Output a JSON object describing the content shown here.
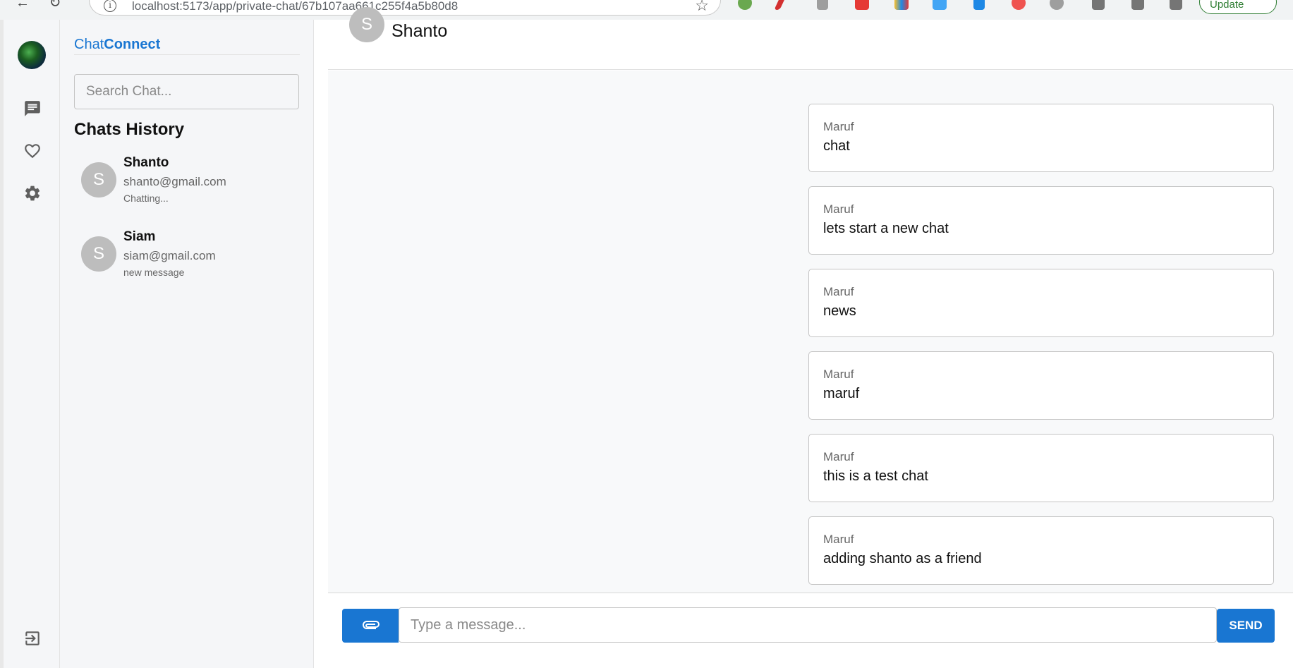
{
  "browser": {
    "url": "localhost:5173/app/private-chat/67b107aa661c255f4a5b80d8",
    "update_label": "Update"
  },
  "rail": {
    "icons": [
      "avatar",
      "chat-icon",
      "heart-icon",
      "gear-icon",
      "logout-icon"
    ]
  },
  "brand": {
    "part1": "Chat",
    "part2": "Connect"
  },
  "search": {
    "placeholder": "Search Chat..."
  },
  "history": {
    "title": "Chats History",
    "items": [
      {
        "initial": "S",
        "name": "Shanto",
        "email": "shanto@gmail.com",
        "status": "Chatting..."
      },
      {
        "initial": "S",
        "name": "Siam",
        "email": "siam@gmail.com",
        "status": "new message"
      }
    ]
  },
  "header": {
    "initial": "S",
    "name": "Shanto"
  },
  "messages": [
    {
      "sender": "Maruf",
      "text": "chat"
    },
    {
      "sender": "Maruf",
      "text": "lets start a new chat"
    },
    {
      "sender": "Maruf",
      "text": "news"
    },
    {
      "sender": "Maruf",
      "text": "maruf"
    },
    {
      "sender": "Maruf",
      "text": "this is a test chat"
    },
    {
      "sender": "Maruf",
      "text": "adding shanto as a friend"
    }
  ],
  "composer": {
    "placeholder": "Type a message...",
    "send_label": "SEND"
  },
  "colors": {
    "accent": "#1976d2",
    "avatar": "#bdbdbd",
    "panel": "#f5f6f8"
  }
}
